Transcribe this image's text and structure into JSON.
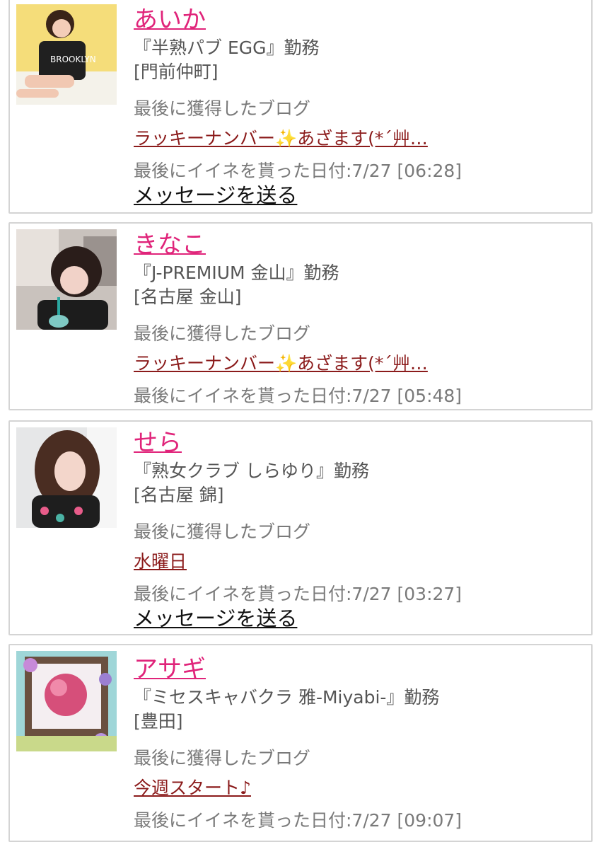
{
  "profiles": [
    {
      "name": "あいか",
      "shop": "『半熟パブ EGG』勤務",
      "area": "[門前仲町]",
      "blog_label": "最後に獲得したブログ",
      "blog_title": "ラッキーナンバー✨あざます(*´艸…",
      "liked": "最後にイイネを貰った日付:7/27 [06:28]",
      "message": "メッセージを送る"
    },
    {
      "name": "きなこ",
      "shop": "『J-PREMIUM 金山』勤務",
      "area": "[名古屋 金山]",
      "blog_label": "最後に獲得したブログ",
      "blog_title": "ラッキーナンバー✨あざます(*´艸…",
      "liked": "最後にイイネを貰った日付:7/27 [05:48]"
    },
    {
      "name": "せら",
      "shop": "『熟女クラブ しらゆり』勤務",
      "area": "[名古屋 錦]",
      "blog_label": "最後に獲得したブログ",
      "blog_title": "水曜日",
      "liked": "最後にイイネを貰った日付:7/27 [03:27]",
      "message": "メッセージを送る"
    },
    {
      "name": "アサギ",
      "shop": "『ミセスキャバクラ 雅-Miyabi-』勤務",
      "area": "[豊田]",
      "blog_label": "最後に獲得したブログ",
      "blog_title": "今週スタート♪",
      "liked": "最後にイイネを貰った日付:7/27 [09:07]"
    }
  ],
  "colors": {
    "name_link": "#e0247a",
    "blog_link": "#8b1b1b",
    "card_border": "#d4d4d4"
  }
}
